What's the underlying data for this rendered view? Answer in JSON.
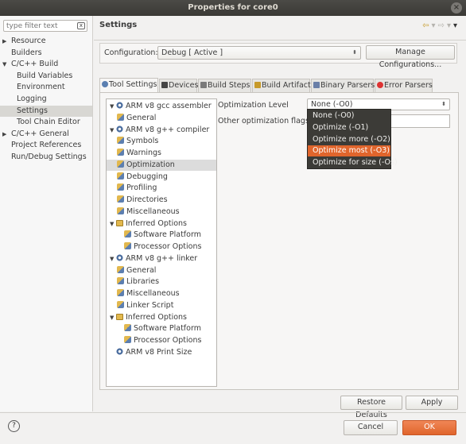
{
  "window": {
    "title": "Properties for core0",
    "close_glyph": "×"
  },
  "filter": {
    "placeholder": "type filter text",
    "clear_glyph": "x"
  },
  "nav": {
    "items": [
      {
        "label": "Resource",
        "indent": 1,
        "arrow": "▶"
      },
      {
        "label": "Builders",
        "indent": 1
      },
      {
        "label": "C/C++ Build",
        "indent": 1,
        "arrow": "▼"
      },
      {
        "label": "Build Variables",
        "indent": 2
      },
      {
        "label": "Environment",
        "indent": 2
      },
      {
        "label": "Logging",
        "indent": 2
      },
      {
        "label": "Settings",
        "indent": 2,
        "selected": true
      },
      {
        "label": "Tool Chain Editor",
        "indent": 2
      },
      {
        "label": "C/C++ General",
        "indent": 1,
        "arrow": "▶"
      },
      {
        "label": "Project References",
        "indent": 1
      },
      {
        "label": "Run/Debug Settings",
        "indent": 1
      }
    ]
  },
  "header": {
    "title": "Settings",
    "back": "⇦",
    "forward": "⇨",
    "menu": "▾"
  },
  "config": {
    "label": "Configuration:",
    "value": "Debug  [ Active ]",
    "manage_button": "Manage Configurations..."
  },
  "tabs": [
    {
      "label": "Tool Settings",
      "icon": "tool-settings-icon",
      "active": true
    },
    {
      "label": "Devices",
      "icon": "devices-icon"
    },
    {
      "label": "Build Steps",
      "icon": "build-steps-icon"
    },
    {
      "label": "Build Artifact",
      "icon": "build-artifact-icon"
    },
    {
      "label": "Binary Parsers",
      "icon": "binary-parsers-icon"
    },
    {
      "label": "Error Parsers",
      "icon": "error-parsers-icon"
    }
  ],
  "tree": [
    {
      "label": "ARM v8 gcc assembler",
      "type": "tool",
      "arrow": "▼"
    },
    {
      "label": "General",
      "type": "option"
    },
    {
      "label": "ARM v8 g++ compiler",
      "type": "tool",
      "arrow": "▼"
    },
    {
      "label": "Symbols",
      "type": "option"
    },
    {
      "label": "Warnings",
      "type": "option"
    },
    {
      "label": "Optimization",
      "type": "option",
      "selected": true
    },
    {
      "label": "Debugging",
      "type": "option"
    },
    {
      "label": "Profiling",
      "type": "option"
    },
    {
      "label": "Directories",
      "type": "option"
    },
    {
      "label": "Miscellaneous",
      "type": "option"
    },
    {
      "label": "Inferred Options",
      "type": "folder",
      "arrow": "▼"
    },
    {
      "label": "Software Platform",
      "type": "option",
      "deep": true
    },
    {
      "label": "Processor Options",
      "type": "option",
      "deep": true
    },
    {
      "label": "ARM v8 g++ linker",
      "type": "tool",
      "arrow": "▼"
    },
    {
      "label": "General",
      "type": "option"
    },
    {
      "label": "Libraries",
      "type": "option"
    },
    {
      "label": "Miscellaneous",
      "type": "option"
    },
    {
      "label": "Linker Script",
      "type": "option"
    },
    {
      "label": "Inferred Options",
      "type": "folder",
      "arrow": "▼"
    },
    {
      "label": "Software Platform",
      "type": "option",
      "deep": true
    },
    {
      "label": "Processor Options",
      "type": "option",
      "deep": true
    },
    {
      "label": "ARM v8 Print Size",
      "type": "tool"
    }
  ],
  "options": {
    "optimization_level_label": "Optimization Level",
    "optimization_level_value": "None (-O0)",
    "other_flags_label": "Other optimization flags",
    "other_flags_value": ""
  },
  "popup": {
    "items": [
      "None (-O0)",
      "Optimize (-O1)",
      "Optimize more (-O2)",
      "Optimize most (-O3)",
      "Optimize for size (-Os)"
    ],
    "highlighted": "Optimize most (-O3)"
  },
  "buttons": {
    "restore": "Restore Defaults",
    "apply": "Apply",
    "cancel": "Cancel",
    "ok": "OK",
    "help_glyph": "?"
  },
  "colors": {
    "accent": "#e0652c",
    "popup_bg": "#3c3b37"
  }
}
